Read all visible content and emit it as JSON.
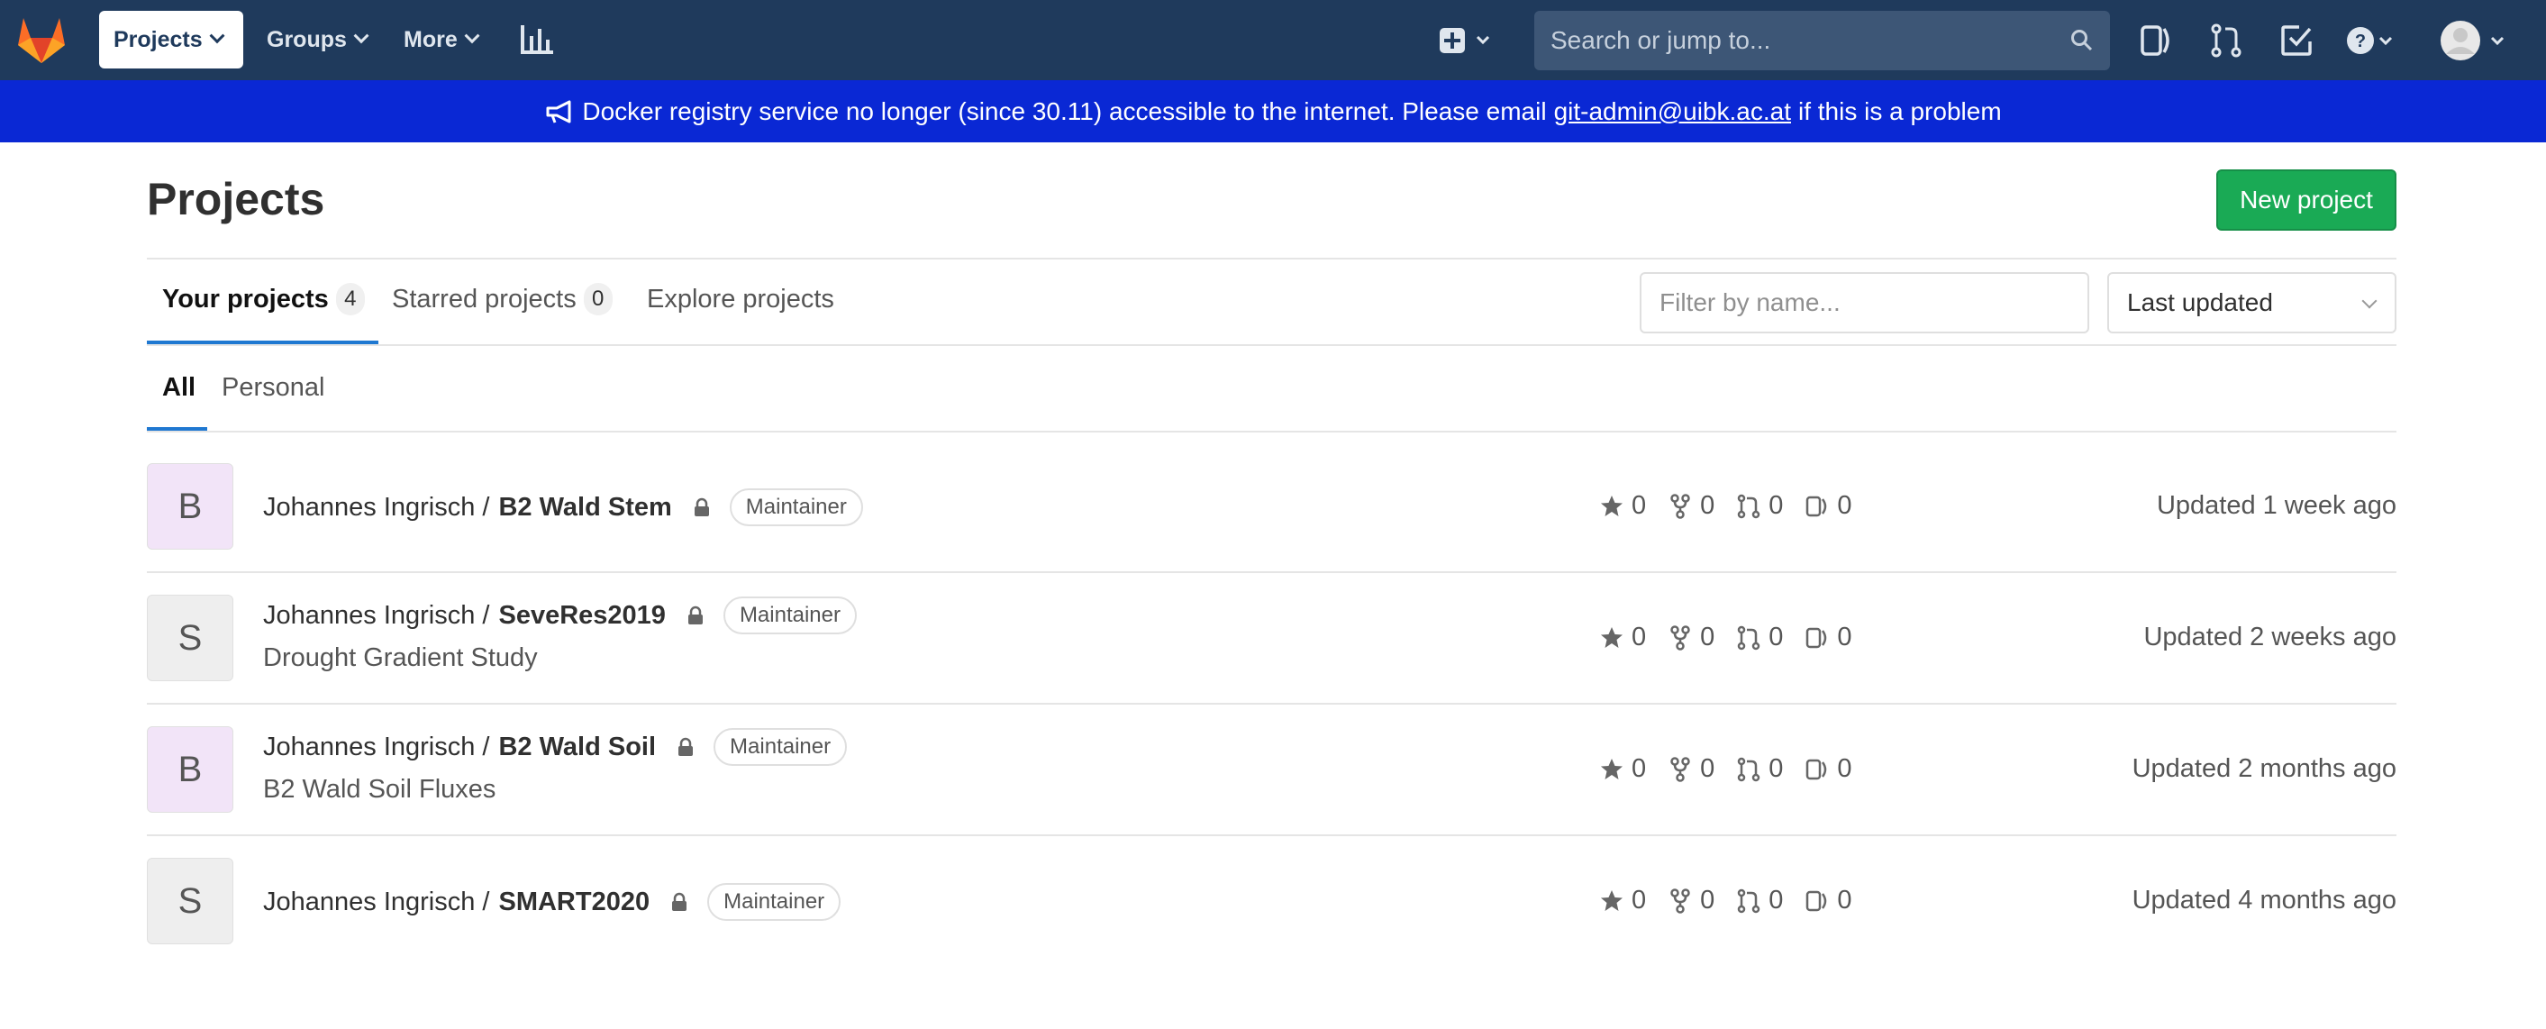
{
  "navbar": {
    "projects_label": "Projects",
    "groups_label": "Groups",
    "more_label": "More",
    "search_placeholder": "Search or jump to...",
    "icons": [
      "gitlab-logo",
      "chart-icon",
      "plus-square-icon",
      "search-icon",
      "issues-icon",
      "merge-request-icon",
      "todo-icon",
      "help-icon",
      "user-avatar"
    ]
  },
  "banner": {
    "text_before": "Docker registry service no longer (since 30.11) accessible to the internet. Please email",
    "email": "git-admin@uibk.ac.at",
    "text_after": "if this is a problem",
    "color": "#0a28d4"
  },
  "page": {
    "title": "Projects",
    "new_project_label": "New project"
  },
  "tabs": [
    {
      "label": "Your projects",
      "count": "4"
    },
    {
      "label": "Starred projects",
      "count": "0"
    },
    {
      "label": "Explore projects"
    }
  ],
  "filter": {
    "placeholder": "Filter by name...",
    "sort_value": "Last updated"
  },
  "subtabs": [
    {
      "label": "All"
    },
    {
      "label": "Personal"
    }
  ],
  "projects": [
    {
      "avatar_letter": "B",
      "avatar_bg": "#f2e4f8",
      "namespace": "Johannes Ingrisch /",
      "name": "B2 Wald Stem",
      "role": "Maintainer",
      "description": "",
      "stars": "0",
      "forks": "0",
      "merge_requests": "0",
      "issues": "0",
      "updated": "Updated 1 week ago"
    },
    {
      "avatar_letter": "S",
      "avatar_bg": "#eeeeee",
      "namespace": "Johannes Ingrisch /",
      "name": "SeveRes2019",
      "role": "Maintainer",
      "description": "Drought Gradient Study",
      "stars": "0",
      "forks": "0",
      "merge_requests": "0",
      "issues": "0",
      "updated": "Updated 2 weeks ago"
    },
    {
      "avatar_letter": "B",
      "avatar_bg": "#f2e4f8",
      "namespace": "Johannes Ingrisch /",
      "name": "B2 Wald Soil",
      "role": "Maintainer",
      "description": "B2 Wald Soil Fluxes",
      "stars": "0",
      "forks": "0",
      "merge_requests": "0",
      "issues": "0",
      "updated": "Updated 2 months ago"
    },
    {
      "avatar_letter": "S",
      "avatar_bg": "#eeeeee",
      "namespace": "Johannes Ingrisch /",
      "name": "SMART2020",
      "role": "Maintainer",
      "description": "",
      "stars": "0",
      "forks": "0",
      "merge_requests": "0",
      "issues": "0",
      "updated": "Updated 4 months ago"
    }
  ]
}
